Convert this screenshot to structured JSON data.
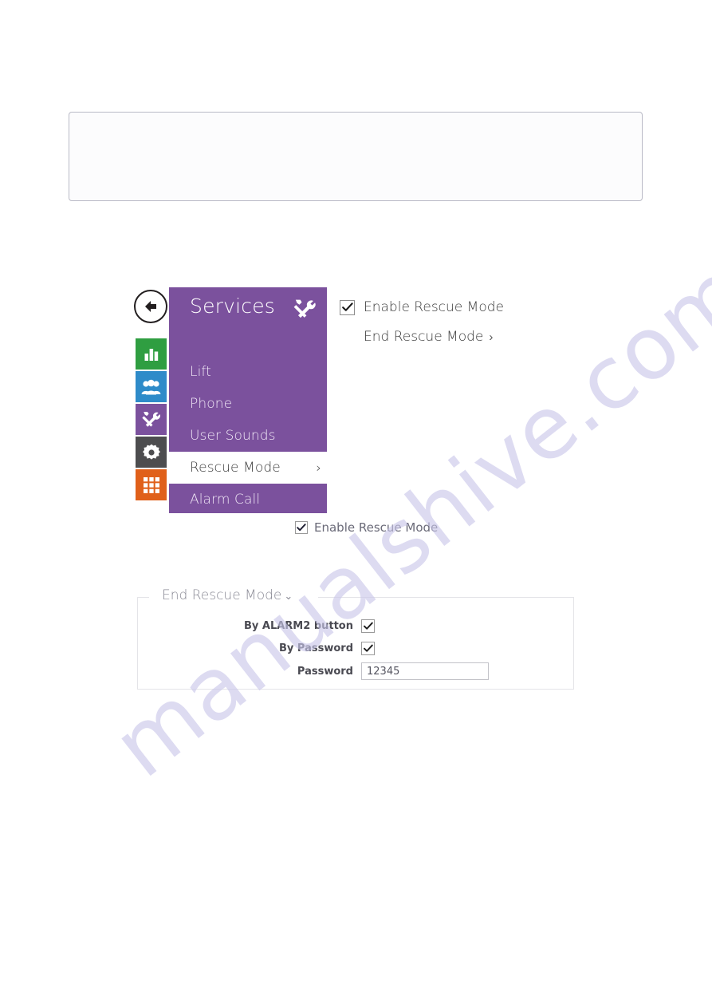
{
  "top_callout": {
    "text": ""
  },
  "device_ui": {
    "back_button": {
      "icon": "arrow-left-icon",
      "label": ""
    },
    "icon_rail": [
      {
        "icon": "bar-chart-icon",
        "color": "#2f9e41",
        "name": "status"
      },
      {
        "icon": "users-icon",
        "color": "#2e8bc9",
        "name": "directory"
      },
      {
        "icon": "tools-icon",
        "color": "#7b519d",
        "name": "services"
      },
      {
        "icon": "gear-icon",
        "color": "#4d4d4f",
        "name": "system"
      },
      {
        "icon": "grid-icon",
        "color": "#e0601a",
        "name": "hardware"
      }
    ],
    "panel": {
      "title": "Services",
      "header_icon": "tools-icon",
      "accent_color": "#7b519d",
      "menu_items": [
        {
          "label": "Lift",
          "selected": false
        },
        {
          "label": "Phone",
          "selected": false
        },
        {
          "label": "User Sounds",
          "selected": false
        },
        {
          "label": "Rescue Mode",
          "selected": true,
          "chevron": "›"
        },
        {
          "label": "Alarm Call",
          "selected": false
        }
      ]
    },
    "options": [
      {
        "type": "checkbox",
        "label": "Enable Rescue Mode",
        "checked": true
      },
      {
        "type": "link",
        "label": "End Rescue Mode",
        "arrow": "›"
      }
    ]
  },
  "mid_checkbox": {
    "label": "Enable Rescue Mode",
    "checked": true
  },
  "end_rescue_fieldset": {
    "legend": "End Rescue Mode",
    "legend_chevron": "⌄",
    "rows": [
      {
        "label": "By ALARM2 button",
        "type": "checkbox",
        "checked": true
      },
      {
        "label": "By Password",
        "type": "checkbox",
        "checked": true
      },
      {
        "label": "Password",
        "type": "text",
        "value": "12345",
        "placeholder": ""
      }
    ]
  },
  "watermark": {
    "text": "manualshive.com",
    "color": "#c9c6ea"
  }
}
